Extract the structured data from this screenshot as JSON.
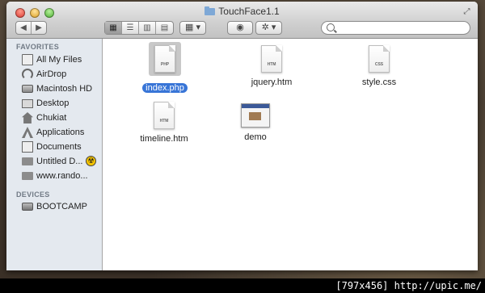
{
  "window": {
    "title": "TouchFace1.1"
  },
  "toolbar": {
    "back_icon": "chevron-left-icon",
    "forward_icon": "chevron-right-icon",
    "view_modes": [
      "icon-view-icon",
      "list-view-icon",
      "column-view-icon",
      "coverflow-view-icon"
    ],
    "arrange_icon": "arrange-grid-icon",
    "quicklook_icon": "eye-icon",
    "action_icon": "gear-icon",
    "search_value": ""
  },
  "sidebar": {
    "favorites_header": "FAVORITES",
    "favorites": [
      {
        "label": "All My Files",
        "icon": "all-files-icon"
      },
      {
        "label": "AirDrop",
        "icon": "airdrop-icon"
      },
      {
        "label": "Macintosh HD",
        "icon": "hard-drive-icon"
      },
      {
        "label": "Desktop",
        "icon": "desktop-icon"
      },
      {
        "label": "Chukiat",
        "icon": "home-icon"
      },
      {
        "label": "Applications",
        "icon": "applications-icon"
      },
      {
        "label": "Documents",
        "icon": "documents-icon"
      },
      {
        "label": "Untitled D...",
        "icon": "folder-icon",
        "badge": "☢"
      },
      {
        "label": "www.rando...",
        "icon": "folder-icon"
      }
    ],
    "devices_header": "DEVICES",
    "devices": [
      {
        "label": "BOOTCAMP",
        "icon": "drive-icon"
      }
    ]
  },
  "files": [
    {
      "name": "index.php",
      "ext": "PHP",
      "selected": true
    },
    {
      "name": "jquery.htm",
      "ext": "HTM"
    },
    {
      "name": "style.css",
      "ext": "CSS"
    },
    {
      "name": "timeline.htm",
      "ext": "HTM"
    },
    {
      "name": "demo",
      "ext": ""
    }
  ],
  "watermark": "[797x456] http://upic.me/"
}
